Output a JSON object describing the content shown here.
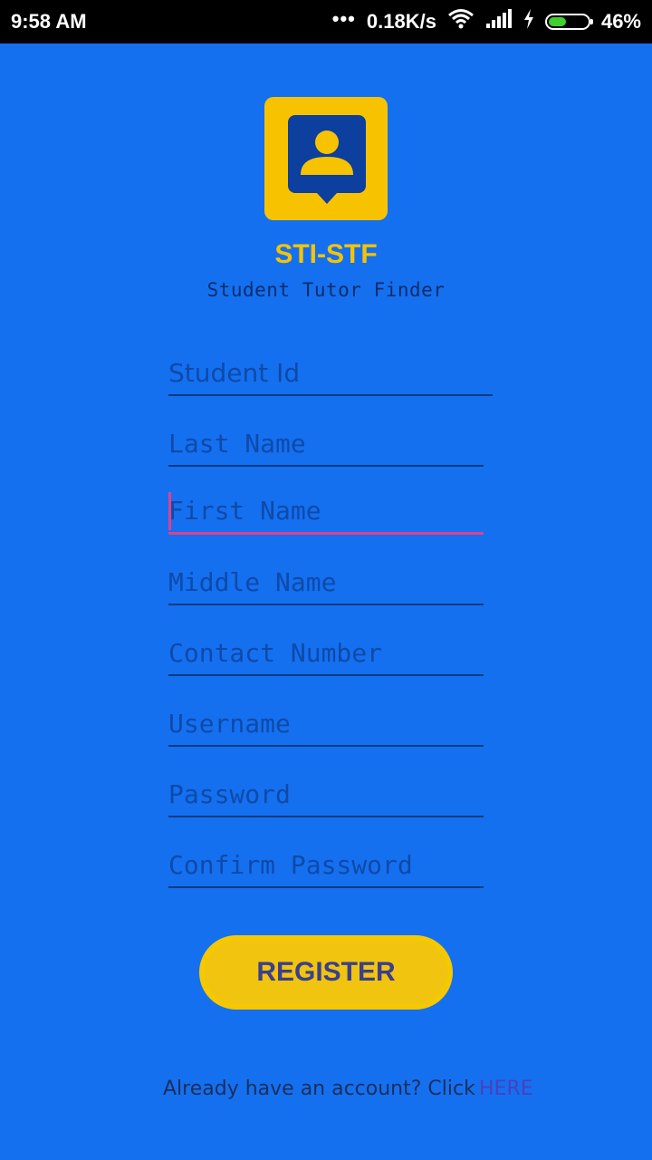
{
  "status_bar": {
    "time": "9:58 AM",
    "dots": "•••",
    "network_speed": "0.18K/s",
    "battery_percent": "46%",
    "battery_level": 0.46,
    "icons": [
      "wifi-icon",
      "signal-icon",
      "charging-icon",
      "battery-icon"
    ]
  },
  "app": {
    "title": "STI-STF",
    "subtitle": "Student Tutor Finder",
    "logo_icon": "user-chat-icon"
  },
  "form": {
    "student_id_placeholder": "Student Id",
    "last_name_placeholder": "Last Name",
    "first_name_placeholder": "First Name",
    "middle_name_placeholder": "Middle Name",
    "contact_number_placeholder": "Contact Number",
    "username_placeholder": "Username",
    "password_placeholder": "Password",
    "confirm_password_placeholder": "Confirm Password",
    "focused_field": "First Name"
  },
  "register_label": "REGISTER",
  "footer": {
    "text": "Already have an account? Click",
    "link": "HERE"
  },
  "colors": {
    "background": "#1570f0",
    "accent_yellow": "#f5c400",
    "focus_pink": "#e2408a"
  }
}
